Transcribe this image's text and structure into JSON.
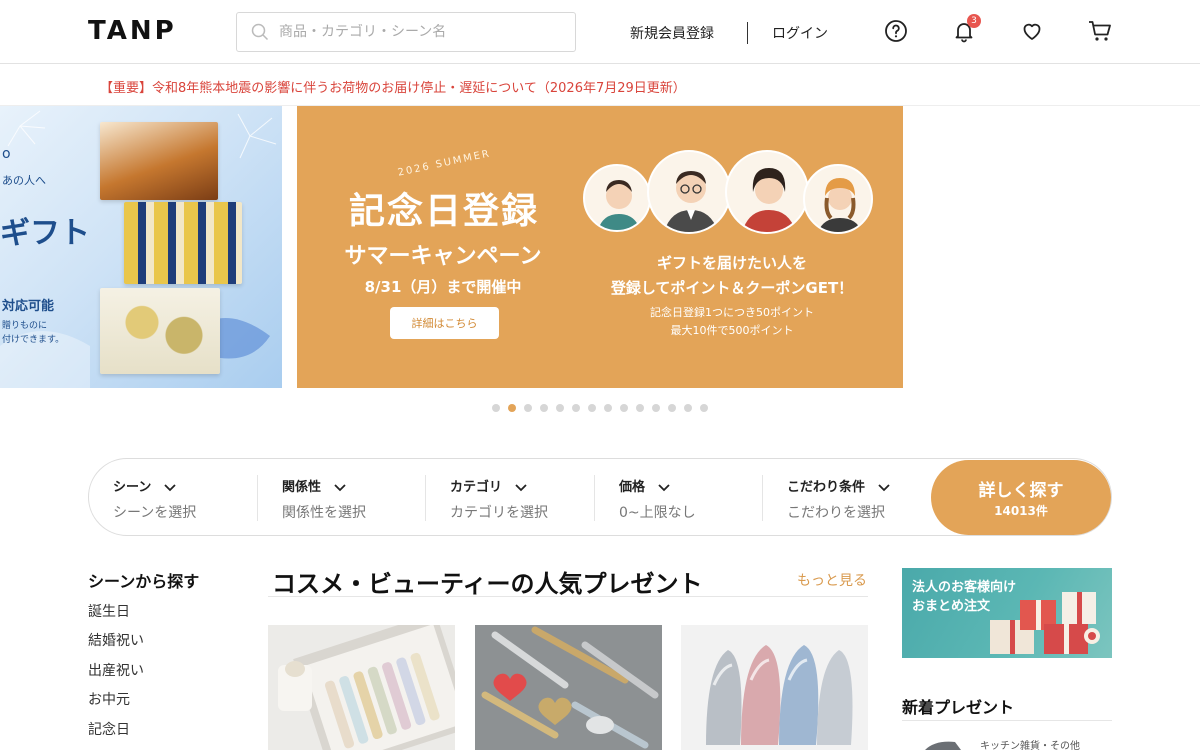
{
  "header": {
    "logo": "TANP",
    "search_placeholder": "商品・カテゴリ・シーン名",
    "register": "新規会員登録",
    "login": "ログイン",
    "notification_count": "3"
  },
  "notice": "【重要】令和8年熊本地震の影響に伴うお荷物のお届け停止・遅延について（2026年7月29日更新）",
  "banner_left": {
    "line1": "あの人へ",
    "line2": "ギフト",
    "line3": "対応可能",
    "line4": "贈りものに",
    "line5": "付けできます。"
  },
  "banner_main": {
    "season": "2026 SUMMER",
    "title": "記念日登録",
    "subtitle": "サマーキャンペーン",
    "date": "8/31（月）まで開催中",
    "button": "詳細はこちら",
    "right_line1": "ギフトを届けたい人を",
    "right_line2": "登録してポイント＆クーポンGET！",
    "right_small1": "記念日登録1つにつき50ポイント",
    "right_small2": "最大10件で500ポイント"
  },
  "carousel": {
    "count": 14,
    "active_index": 1
  },
  "filters": [
    {
      "label": "シーン",
      "value": "シーンを選択"
    },
    {
      "label": "関係性",
      "value": "関係性を選択"
    },
    {
      "label": "カテゴリ",
      "value": "カテゴリを選択"
    },
    {
      "label": "価格",
      "value": "0~上限なし"
    },
    {
      "label": "こだわり条件",
      "value": "こだわりを選択"
    }
  ],
  "search_button": {
    "label": "詳しく探す",
    "count": "14013件"
  },
  "sidebar": {
    "title": "シーンから探す",
    "items": [
      "誕生日",
      "結婚祝い",
      "出産祝い",
      "お中元",
      "記念日"
    ]
  },
  "section": {
    "title": "コスメ・ビューティーの人気プレゼント",
    "more": "もっと見る"
  },
  "right_panel": {
    "corporate_line1": "法人のお客様向け",
    "corporate_line2": "おまとめ注文",
    "new_title": "新着プレゼント",
    "new_item_category": "キッチン雑貨・その他"
  },
  "colors": {
    "accent": "#e3a458",
    "notice": "#d9443b",
    "badge": "#e8564f",
    "corporate": "#4aa9aa"
  }
}
